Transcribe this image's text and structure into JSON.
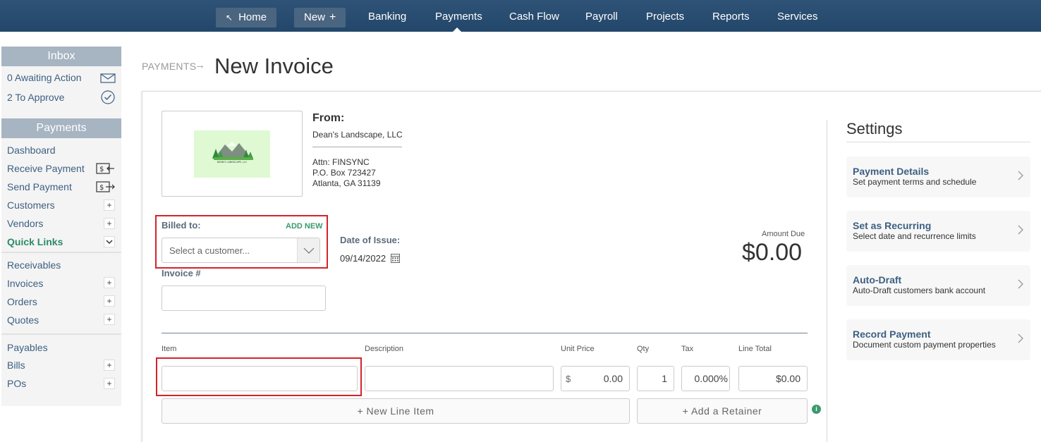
{
  "topnav": {
    "home": "Home",
    "new": "New",
    "items": [
      "Banking",
      "Payments",
      "Cash Flow",
      "Payroll",
      "Projects",
      "Reports",
      "Services"
    ]
  },
  "sidebar": {
    "inbox_header": "Inbox",
    "inbox_items": [
      "0 Awaiting Action",
      "2 To Approve"
    ],
    "payments_header": "Payments",
    "payment_items": [
      "Dashboard",
      "Receive Payment",
      "Send Payment",
      "Customers",
      "Vendors"
    ],
    "quick_links": "Quick Links",
    "receivables_header": "Receivables",
    "receivable_items": [
      "Invoices",
      "Orders",
      "Quotes"
    ],
    "payables_header": "Payables",
    "payable_items": [
      "Bills",
      "POs"
    ],
    "plus": "+"
  },
  "breadcrumb": {
    "parent": "PAYMENTS",
    "arrow": "→"
  },
  "page_title": "New Invoice",
  "logo_text": "DEAN'S LANDSCAPE, LLC",
  "from": {
    "label": "From:",
    "name": "Dean's Landscape, LLC",
    "address": [
      "Attn: FINSYNC",
      "P.O. Box 723427",
      "Atlanta, GA 31139"
    ]
  },
  "billed_to": {
    "label": "Billed to:",
    "add_new": "ADD NEW",
    "placeholder": "Select a customer..."
  },
  "date_of_issue": {
    "label": "Date of Issue:",
    "value": "09/14/2022"
  },
  "invoice_number": {
    "label": "Invoice #",
    "value": ""
  },
  "amount_due": {
    "label": "Amount Due",
    "value": "$0.00"
  },
  "line_items": {
    "columns": [
      "Item",
      "Description",
      "Unit Price",
      "Qty",
      "Tax",
      "Line Total"
    ],
    "row": {
      "item": "",
      "description": "",
      "currency": "$",
      "unit_price": "0.00",
      "qty": "1",
      "tax": "0.000%",
      "line_total": "$0.00"
    },
    "new_line_button": "+ New Line Item",
    "add_retainer_button": "+ Add a Retainer",
    "info": "i"
  },
  "settings": {
    "title": "Settings",
    "cards": [
      {
        "title": "Payment Details",
        "subtitle": "Set payment terms and schedule"
      },
      {
        "title": "Set as Recurring",
        "subtitle": "Select date and recurrence limits"
      },
      {
        "title": "Auto-Draft",
        "subtitle": "Auto-Draft customers bank account"
      },
      {
        "title": "Record Payment",
        "subtitle": "Document custom payment properties"
      }
    ]
  },
  "colors": {
    "nav": "#2f5377",
    "accent_green": "#3a9a6e",
    "link_blue": "#3d5f82",
    "highlight_red": "#d4232b"
  }
}
